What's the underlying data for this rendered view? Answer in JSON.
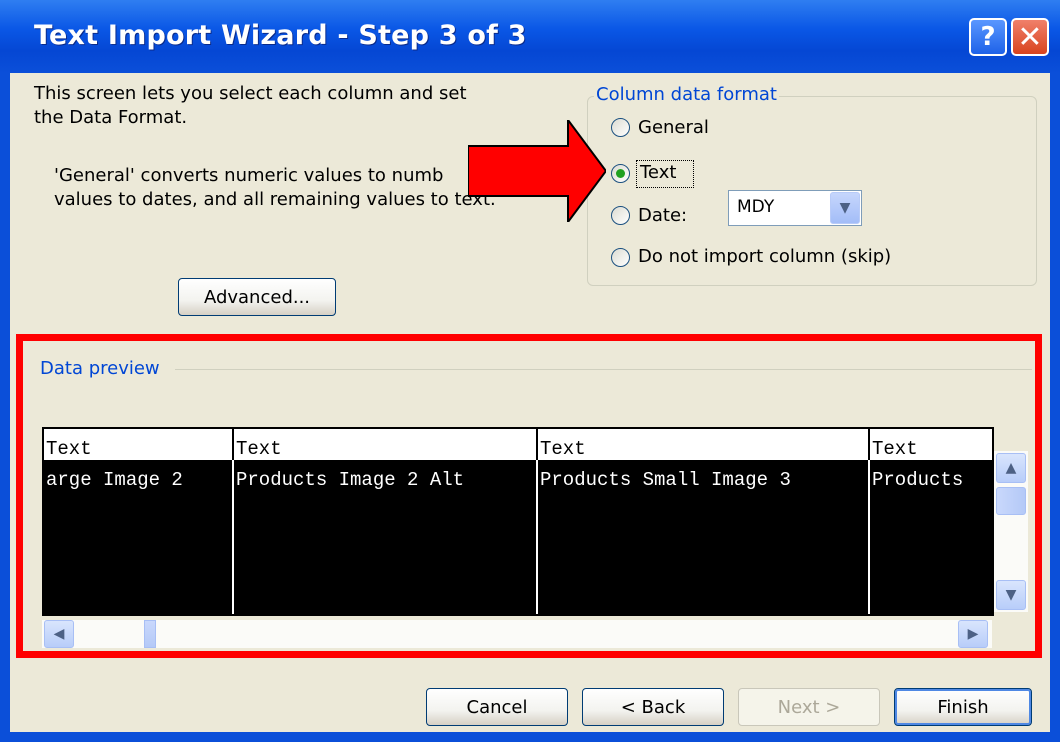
{
  "window": {
    "title": "Text Import Wizard - Step 3 of 3",
    "help_glyph": "?",
    "close_glyph": "✕"
  },
  "intro": {
    "line1": "This screen lets you select each column and set",
    "line2": "the Data Format.",
    "desc1": "'General' converts numeric values to numb",
    "desc2": "values to dates, and all remaining values to text."
  },
  "advanced_button": {
    "label": "Advanced..."
  },
  "column_format": {
    "legend": "Column data format",
    "options": [
      {
        "label": "General",
        "selected": false
      },
      {
        "label": "Text",
        "selected": true
      },
      {
        "label": "Date:",
        "selected": false
      },
      {
        "label": "Do not import column (skip)",
        "selected": false
      }
    ],
    "date_format": {
      "value": "MDY"
    }
  },
  "preview": {
    "legend": "Data preview",
    "columns": [
      {
        "header": "Text",
        "cell": "arge Image 2"
      },
      {
        "header": "Text",
        "cell": "Products Image 2 Alt"
      },
      {
        "header": "Text",
        "cell": "Products Small Image 3"
      },
      {
        "header": "Text",
        "cell": "Products"
      }
    ]
  },
  "buttons": {
    "cancel": "Cancel",
    "back": "< Back",
    "next": "Next >",
    "finish": "Finish"
  },
  "colors": {
    "annotation": "#ff0000",
    "title_bar": "#0b4fd9",
    "legend_text": "#0046d5"
  }
}
